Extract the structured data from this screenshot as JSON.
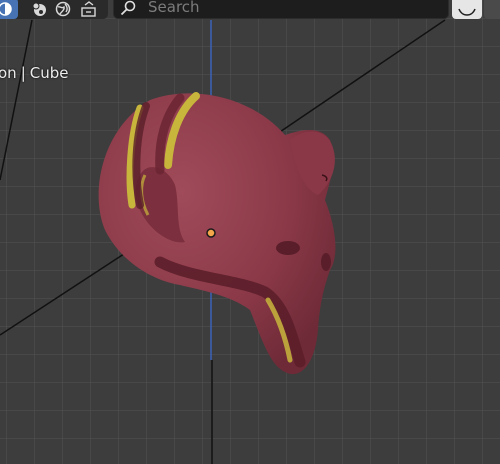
{
  "header": {
    "search": {
      "placeholder": "Search",
      "value": ""
    },
    "shading_modes": [
      {
        "icon": "wireframe-sphere-icon",
        "active": true
      },
      {
        "icon": "material-preview-icon",
        "active": false
      },
      {
        "icon": "rendered-globe-icon",
        "active": false
      },
      {
        "icon": "scene-export-icon",
        "active": false
      }
    ]
  },
  "viewport": {
    "object_info": {
      "mode": "on",
      "object": "Cube"
    },
    "colors": {
      "background": "#3d3d3d",
      "grid": "#545454",
      "axis_z": "#3b63b8",
      "mesh": "#8c3a49",
      "stripe": "#c8b63c",
      "origin_point": "#f5a74b"
    }
  }
}
